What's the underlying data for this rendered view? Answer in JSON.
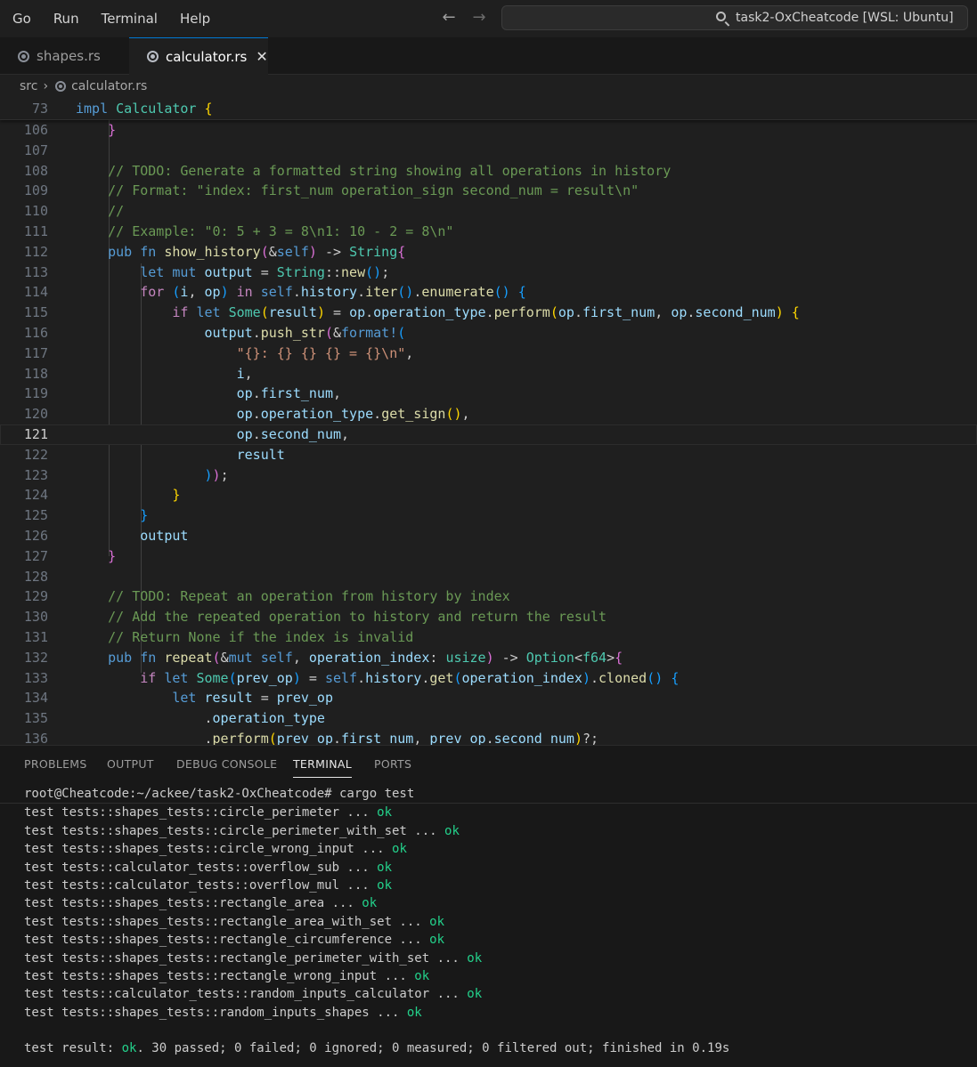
{
  "menu": [
    "Go",
    "Run",
    "Terminal",
    "Help"
  ],
  "search": {
    "text": "task2-OxCheatcode [WSL: Ubuntu]"
  },
  "tabs": [
    {
      "label": "shapes.rs"
    },
    {
      "label": "calculator.rs"
    }
  ],
  "breadcrumb": {
    "folder": "src",
    "file": "calculator.rs"
  },
  "sticky_line": {
    "num": "73"
  },
  "line_numbers": [
    "106",
    "107",
    "108",
    "109",
    "110",
    "111",
    "112",
    "113",
    "114",
    "115",
    "116",
    "117",
    "118",
    "119",
    "120",
    "121",
    "122",
    "123",
    "124",
    "125",
    "126",
    "127",
    "128",
    "129",
    "130",
    "131",
    "132",
    "133",
    "134",
    "135",
    "136"
  ],
  "current_line": "121",
  "panel": {
    "tabs": [
      "PROBLEMS",
      "OUTPUT",
      "DEBUG CONSOLE",
      "TERMINAL",
      "PORTS"
    ],
    "active_tab": "TERMINAL"
  },
  "terminal": {
    "prompt": "root@Cheatcode:~/ackee/task2-OxCheatcode# cargo test",
    "tests": [
      {
        "name": "test tests::shapes_tests::circle_perimeter ... ",
        "status": "ok"
      },
      {
        "name": "test tests::shapes_tests::circle_perimeter_with_set ... ",
        "status": "ok"
      },
      {
        "name": "test tests::shapes_tests::circle_wrong_input ... ",
        "status": "ok"
      },
      {
        "name": "test tests::calculator_tests::overflow_sub ... ",
        "status": "ok"
      },
      {
        "name": "test tests::calculator_tests::overflow_mul ... ",
        "status": "ok"
      },
      {
        "name": "test tests::shapes_tests::rectangle_area ... ",
        "status": "ok"
      },
      {
        "name": "test tests::shapes_tests::rectangle_area_with_set ... ",
        "status": "ok"
      },
      {
        "name": "test tests::shapes_tests::rectangle_circumference ... ",
        "status": "ok"
      },
      {
        "name": "test tests::shapes_tests::rectangle_perimeter_with_set ... ",
        "status": "ok"
      },
      {
        "name": "test tests::shapes_tests::rectangle_wrong_input ... ",
        "status": "ok"
      },
      {
        "name": "test tests::calculator_tests::random_inputs_calculator ... ",
        "status": "ok"
      },
      {
        "name": "test tests::shapes_tests::random_inputs_shapes ... ",
        "status": "ok"
      }
    ],
    "result_prefix": "test result: ",
    "result_status": "ok",
    "result_suffix": ". 30 passed; 0 failed; 0 ignored; 0 measured; 0 filtered out; finished in 0.19s"
  },
  "colors": {
    "accent": "#0078d4",
    "ok": "#23d18b",
    "keyword": "#569cd6",
    "type": "#4ec9b0",
    "comment": "#6a9955",
    "string": "#ce9178"
  }
}
